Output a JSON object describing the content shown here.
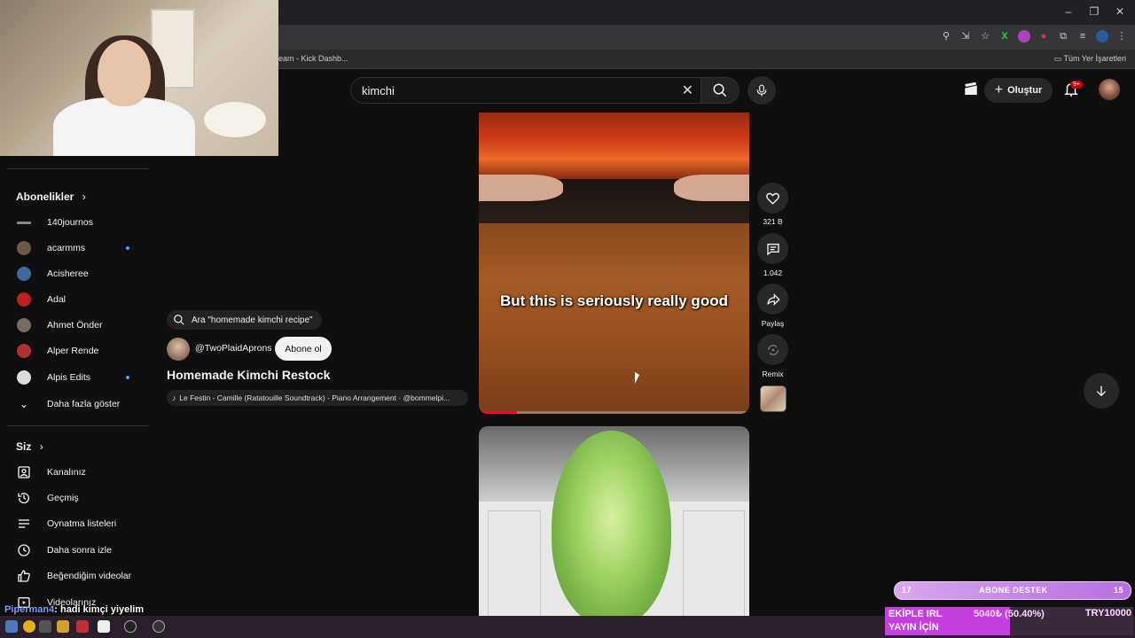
{
  "browser": {
    "bookmark_left": "eam - Kick Dashb...",
    "bookmark_right": "Tüm Yer İşaretleri"
  },
  "search": {
    "query": "kimchi"
  },
  "header": {
    "create_label": "Oluştur",
    "notif_count": "9+"
  },
  "sidebar": {
    "subs_title": "Abonelikler",
    "subscriptions": [
      {
        "name": "140journos",
        "color": "#888888",
        "new": false
      },
      {
        "name": "acarmms",
        "color": "#6a5a4a",
        "new": true
      },
      {
        "name": "Acisheree",
        "color": "#3a6aa0",
        "new": false
      },
      {
        "name": "Adal",
        "color": "#c02020",
        "new": false
      },
      {
        "name": "Ahmet Önder",
        "color": "#7a6a5a",
        "new": false
      },
      {
        "name": "Alper Rende",
        "color": "#b03030",
        "new": false
      },
      {
        "name": "Alpis Edits",
        "color": "#dddddd",
        "new": true
      }
    ],
    "show_more": "Daha fazla göster",
    "you_title": "Siz",
    "you_items": [
      {
        "label": "Kanalınız",
        "icon": "user-box-icon"
      },
      {
        "label": "Geçmiş",
        "icon": "history-icon"
      },
      {
        "label": "Oynatma listeleri",
        "icon": "playlist-icon"
      },
      {
        "label": "Daha sonra izle",
        "icon": "clock-icon"
      },
      {
        "label": "Beğendiğim videolar",
        "icon": "thumbs-up-icon"
      },
      {
        "label": "Videolarınız",
        "icon": "play-square-icon"
      }
    ]
  },
  "short": {
    "search_suggest": "Ara \"homemade kimchi recipe\"",
    "channel": "@TwoPlaidAprons",
    "subscribe": "Abone ol",
    "title": "Homemade Kimchi Restock",
    "music": "Le Festin - Camille (Ratatouille Soundtrack) - Piano Arrangement · @bommelpi...",
    "caption": "But this is seriously really good",
    "progress": 0.14
  },
  "actions": {
    "likes": "321 B",
    "comments": "1.042",
    "share": "Paylaş",
    "remix": "Remix"
  },
  "stream": {
    "chat_user": "Piperman4",
    "chat_msg": ": hadi kimçi yiyelim",
    "sub_left": "17",
    "sub_title": "ABONE DESTEK",
    "sub_right": "15",
    "donate_label1": "EKİPLE IRL",
    "donate_label2": "YAYIN İÇİN",
    "donate_amount": "5040₺ (50.40%)",
    "donate_goal": "TRY10000",
    "donate_fraction": 0.504
  }
}
